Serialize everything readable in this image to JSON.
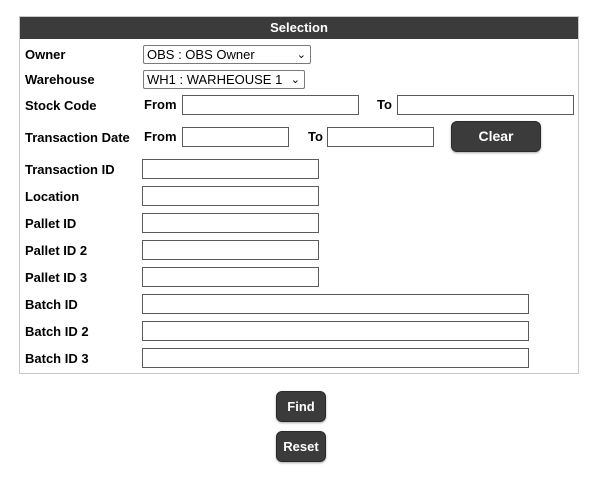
{
  "selection": {
    "title": "Selection",
    "owner": {
      "label": "Owner",
      "value": "OBS : OBS Owner"
    },
    "warehouse": {
      "label": "Warehouse",
      "value": "WH1 : WARHEOUSE 1"
    },
    "stock_code": {
      "label": "Stock Code",
      "from_label": "From",
      "to_label": "To",
      "from_value": "",
      "to_value": ""
    },
    "transaction_date": {
      "label": "Transaction Date",
      "from_label": "From",
      "to_label": "To",
      "from_value": "",
      "to_value": ""
    },
    "clear_label": "Clear",
    "transaction_id": {
      "label": "Transaction ID",
      "value": ""
    },
    "location": {
      "label": "Location",
      "value": ""
    },
    "pallet_id": {
      "label": "Pallet ID",
      "value": ""
    },
    "pallet_id_2": {
      "label": "Pallet ID 2",
      "value": ""
    },
    "pallet_id_3": {
      "label": "Pallet ID 3",
      "value": ""
    },
    "batch_id": {
      "label": "Batch ID",
      "value": ""
    },
    "batch_id_2": {
      "label": "Batch ID 2",
      "value": ""
    },
    "batch_id_3": {
      "label": "Batch ID 3",
      "value": ""
    }
  },
  "actions": {
    "find_label": "Find",
    "reset_label": "Reset"
  },
  "icons": {
    "dropdown": "chevron-down-icon"
  },
  "colors": {
    "header_bg": "#3b3b3b",
    "button_bg": "#3b3b3b",
    "button_text": "#ffffff"
  }
}
